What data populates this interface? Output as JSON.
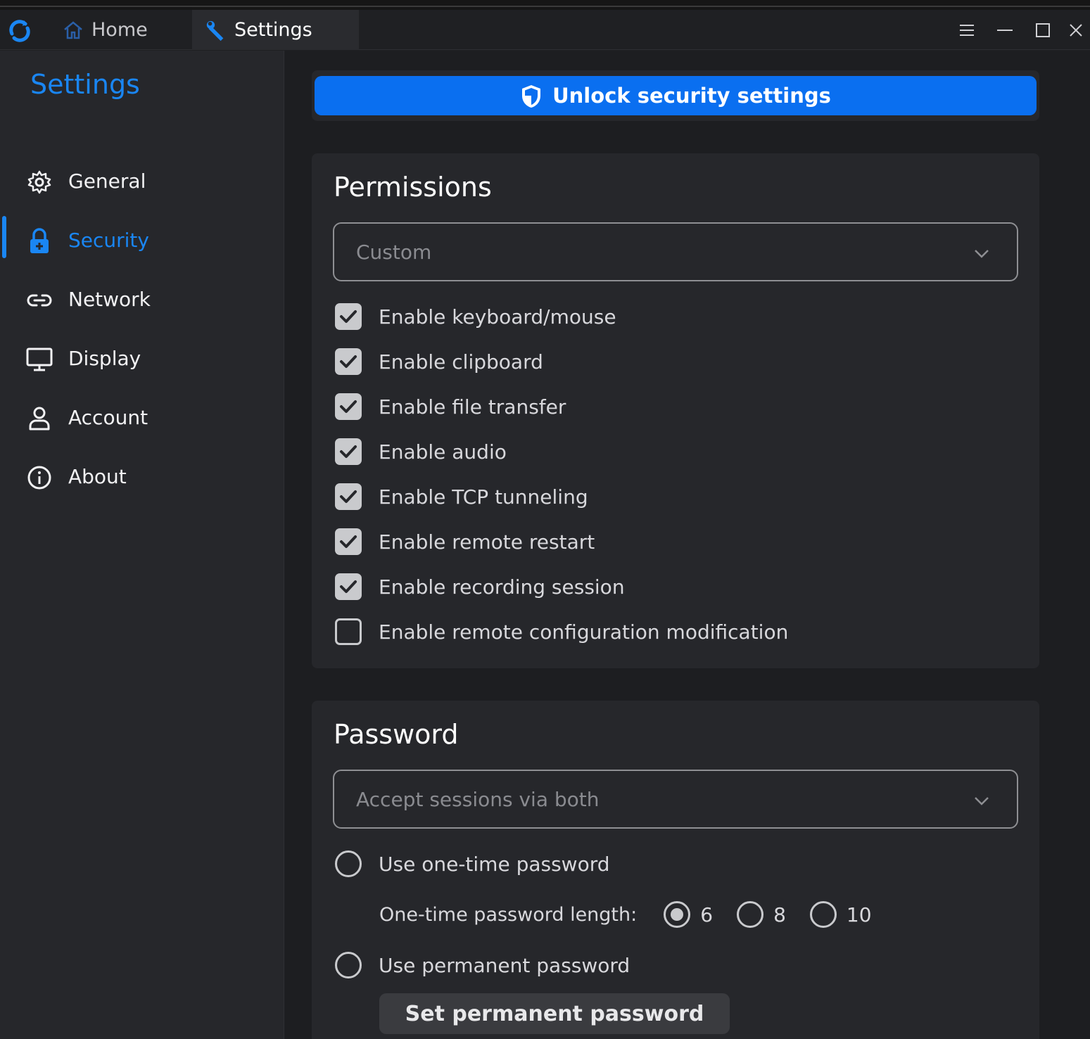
{
  "titlebar": {
    "tabs": [
      {
        "label": "Home",
        "icon": "home-icon"
      },
      {
        "label": "Settings",
        "icon": "wrench-icon"
      }
    ],
    "controls": [
      "menu-icon",
      "minimize-icon",
      "maximize-icon",
      "close-icon"
    ]
  },
  "sidebar": {
    "title": "Settings",
    "items": [
      {
        "label": "General",
        "icon": "gear-icon"
      },
      {
        "label": "Security",
        "icon": "lock-icon",
        "active": true
      },
      {
        "label": "Network",
        "icon": "link-icon"
      },
      {
        "label": "Display",
        "icon": "monitor-icon"
      },
      {
        "label": "Account",
        "icon": "user-icon"
      },
      {
        "label": "About",
        "icon": "info-icon"
      }
    ]
  },
  "unlock": {
    "label": "Unlock security settings",
    "icon": "shield-icon"
  },
  "permissions": {
    "title": "Permissions",
    "preset": "Custom",
    "options": [
      {
        "label": "Enable keyboard/mouse",
        "checked": true
      },
      {
        "label": "Enable clipboard",
        "checked": true
      },
      {
        "label": "Enable file transfer",
        "checked": true
      },
      {
        "label": "Enable audio",
        "checked": true
      },
      {
        "label": "Enable TCP tunneling",
        "checked": true
      },
      {
        "label": "Enable remote restart",
        "checked": true
      },
      {
        "label": "Enable recording session",
        "checked": true
      },
      {
        "label": "Enable remote configuration modification",
        "checked": false
      }
    ]
  },
  "password": {
    "title": "Password",
    "mode": "Accept sessions via both",
    "one_time_label": "Use one-time password",
    "one_time_selected": false,
    "length_label": "One-time password length:",
    "lengths": [
      {
        "label": "6",
        "selected": true
      },
      {
        "label": "8",
        "selected": false
      },
      {
        "label": "10",
        "selected": false
      }
    ],
    "permanent_label": "Use permanent password",
    "permanent_selected": false,
    "set_button": "Set permanent password"
  },
  "colors": {
    "accent": "#1a86f3",
    "button": "#0a6ff0",
    "panel": "#26272b",
    "background": "#1d1e21"
  }
}
